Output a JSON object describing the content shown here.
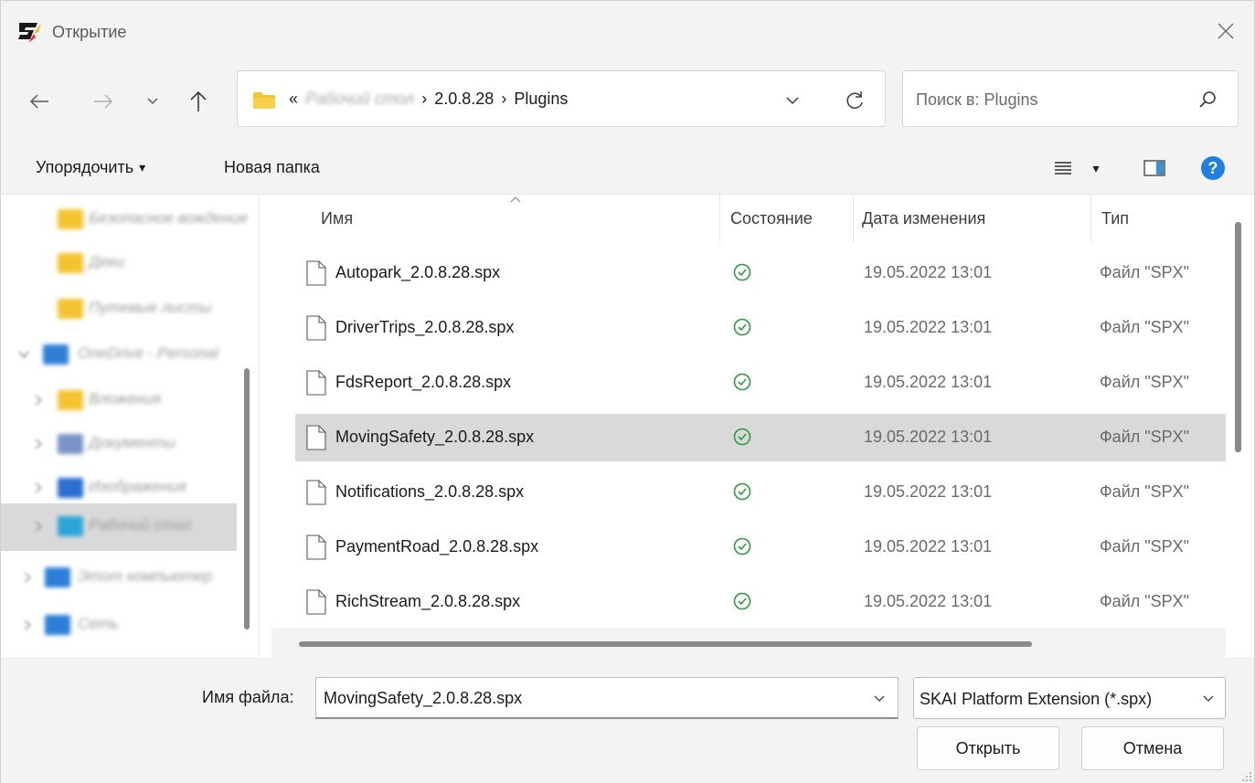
{
  "window": {
    "title": "Открытие",
    "close_symbol": "×",
    "app_icon": "app-logo-icon"
  },
  "nav": {
    "back_icon": "back-arrow-icon",
    "forward_icon": "forward-arrow-icon",
    "recent_icon": "chevron-down-icon",
    "up_icon": "up-arrow-icon"
  },
  "address": {
    "overflow": "«",
    "blurred_crumb": "Рабочий стол",
    "sep": "›",
    "crumbs": [
      "2.0.8.28",
      "Plugins"
    ],
    "dropdown_icon": "chevron-down-icon",
    "refresh_icon": "refresh-icon"
  },
  "search": {
    "placeholder": "Поиск в: Plugins",
    "icon": "search-icon"
  },
  "toolbar": {
    "organize": "Упорядочить",
    "organize_arrow": "▾",
    "new_folder": "Новая папка",
    "view_icon": "view-list-icon",
    "view_arrow": "▾",
    "preview_icon": "preview-pane-icon",
    "help_icon": "help-icon",
    "help_label": "?"
  },
  "sidebar": {
    "items": [
      {
        "label": "Безопасное вождение",
        "icon": "folder-icon",
        "color": "#f4c430"
      },
      {
        "label": "Деки",
        "icon": "folder-icon",
        "color": "#f4c430"
      },
      {
        "label": "Путевые листы",
        "icon": "folder-icon",
        "color": "#f4c430"
      },
      {
        "label": "OneDrive - Personal",
        "icon": "onedrive-icon",
        "color": "#2f7fd6"
      },
      {
        "label": "Вложения",
        "icon": "folder-icon",
        "color": "#f4c430"
      },
      {
        "label": "Документы",
        "icon": "documents-icon",
        "color": "#7a94c8"
      },
      {
        "label": "Изображения",
        "icon": "pictures-icon",
        "color": "#2b6fd1"
      },
      {
        "label": "Рабочий стол",
        "icon": "desktop-icon",
        "color": "#2ba6d8",
        "selected": true
      },
      {
        "label": "Этот компьютер",
        "icon": "computer-icon",
        "color": "#2b7fd8"
      },
      {
        "label": "Сеть",
        "icon": "network-icon",
        "color": "#2b7fd8"
      }
    ]
  },
  "columns": {
    "name": "Имя",
    "status": "Состояние",
    "date": "Дата изменения",
    "type": "Тип"
  },
  "files": [
    {
      "name": "Autopark_2.0.8.28.spx",
      "status": "synced",
      "date": "19.05.2022 13:01",
      "type": "Файл \"SPX\""
    },
    {
      "name": "DriverTrips_2.0.8.28.spx",
      "status": "synced",
      "date": "19.05.2022 13:01",
      "type": "Файл \"SPX\""
    },
    {
      "name": "FdsReport_2.0.8.28.spx",
      "status": "synced",
      "date": "19.05.2022 13:01",
      "type": "Файл \"SPX\""
    },
    {
      "name": "MovingSafety_2.0.8.28.spx",
      "status": "synced",
      "date": "19.05.2022 13:01",
      "type": "Файл \"SPX\"",
      "selected": true
    },
    {
      "name": "Notifications_2.0.8.28.spx",
      "status": "synced",
      "date": "19.05.2022 13:01",
      "type": "Файл \"SPX\""
    },
    {
      "name": "PaymentRoad_2.0.8.28.spx",
      "status": "synced",
      "date": "19.05.2022 13:01",
      "type": "Файл \"SPX\""
    },
    {
      "name": "RichStream_2.0.8.28.spx",
      "status": "synced",
      "date": "19.05.2022 13:01",
      "type": "Файл \"SPX\""
    }
  ],
  "bottom": {
    "filename_label": "Имя файла:",
    "filename_value": "MovingSafety_2.0.8.28.spx",
    "filter_value": "SKAI Platform Extension (*.spx)",
    "open_label": "Открыть",
    "cancel_label": "Отмена"
  },
  "colors": {
    "accent": "#0067c0",
    "status_ok": "#2a9d3a",
    "folder": "#f4c430",
    "selection": "#d9d9d9"
  }
}
